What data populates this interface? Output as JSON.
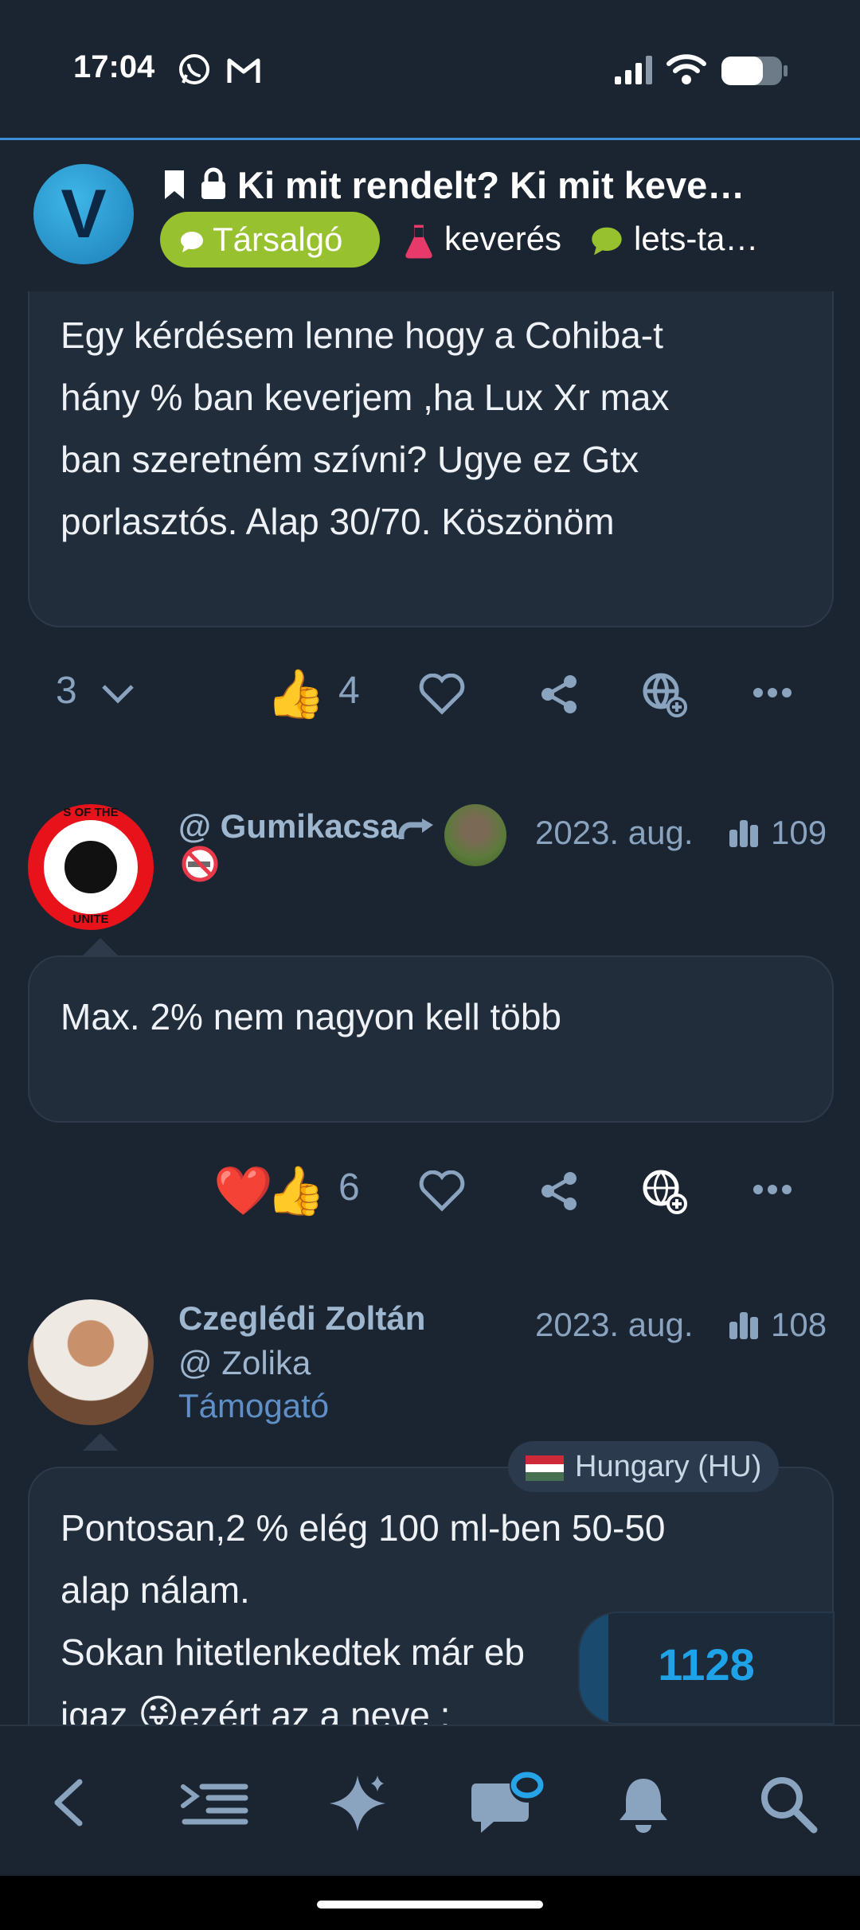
{
  "status_bar": {
    "time": "17:04"
  },
  "header": {
    "logo_letter": "V",
    "title": "Ki mit rendelt? Ki mit keve…",
    "category": "Társalgó",
    "tags": [
      "keverés",
      "lets-ta…"
    ]
  },
  "post1": {
    "body_lines": [
      "Egy kérdésem lenne hogy a Cohiba-t",
      "hány % ban keverjem ,ha Lux Xr max",
      "ban szeretném szívni? Ugye ez Gtx",
      "porlasztós. Alap 30/70. Köszönöm"
    ],
    "replies_count": "3",
    "likes_count": "4"
  },
  "post2": {
    "author": "@ Gumikacsa",
    "date": "2023. aug.",
    "views": "109",
    "avatar_text_top": "S OF THE",
    "avatar_text_bottom": "UNITE",
    "body": "Max. 2% nem nagyon kell több",
    "likes_count": "6"
  },
  "post3": {
    "name": "Czeglédi Zoltán",
    "username": "@ Zolika",
    "role": "Támogató",
    "date": "2023. aug.",
    "views": "108",
    "translate_badge": "Hungary (HU)",
    "body_lines": [
      "Pontosan,2 % elég 100 ml-ben 50-50",
      "alap nálam.",
      "Sokan hitetlenkedtek már eb",
      "igaz",
      "ezért az a neve :"
    ]
  },
  "progress_badge": "1128",
  "colors": {
    "background": "#1b2532",
    "card": "#212d3b",
    "accent": "#3d8fd8",
    "category_chip": "#97c12e",
    "muted": "#8aa3bf"
  }
}
